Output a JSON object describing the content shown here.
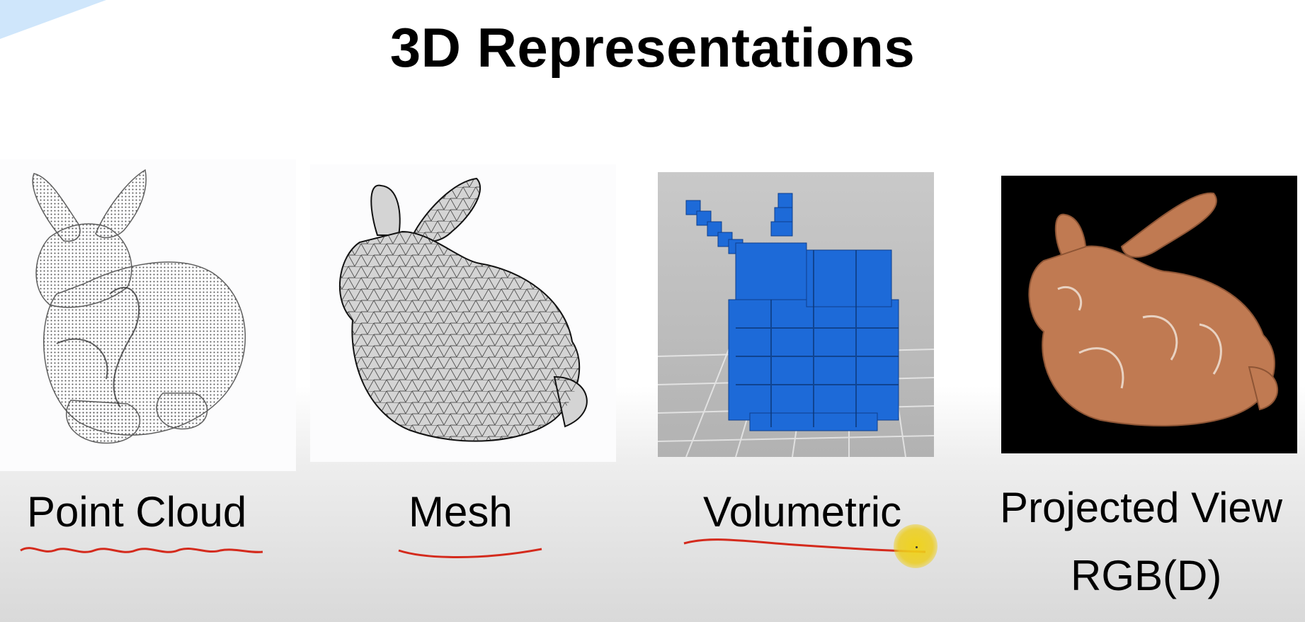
{
  "slide": {
    "title": "3D Representations"
  },
  "panels": [
    {
      "label": "Point Cloud",
      "underlined": true
    },
    {
      "label": "Mesh",
      "underlined": true
    },
    {
      "label": "Volumetric",
      "underlined": true
    },
    {
      "label_line1": "Projected View",
      "label_line2": "RGB(D)",
      "underlined": false
    }
  ],
  "colors": {
    "annotation_red": "#d42a1c",
    "voxel_blue": "#1d6ad8",
    "photo_background": "#000000",
    "bunny_tan": "#c07a52",
    "pointer_yellow": "#f0d214",
    "corner_accent": "#cfe6fb"
  },
  "icons": {
    "pointer": "laser-pointer-icon"
  }
}
